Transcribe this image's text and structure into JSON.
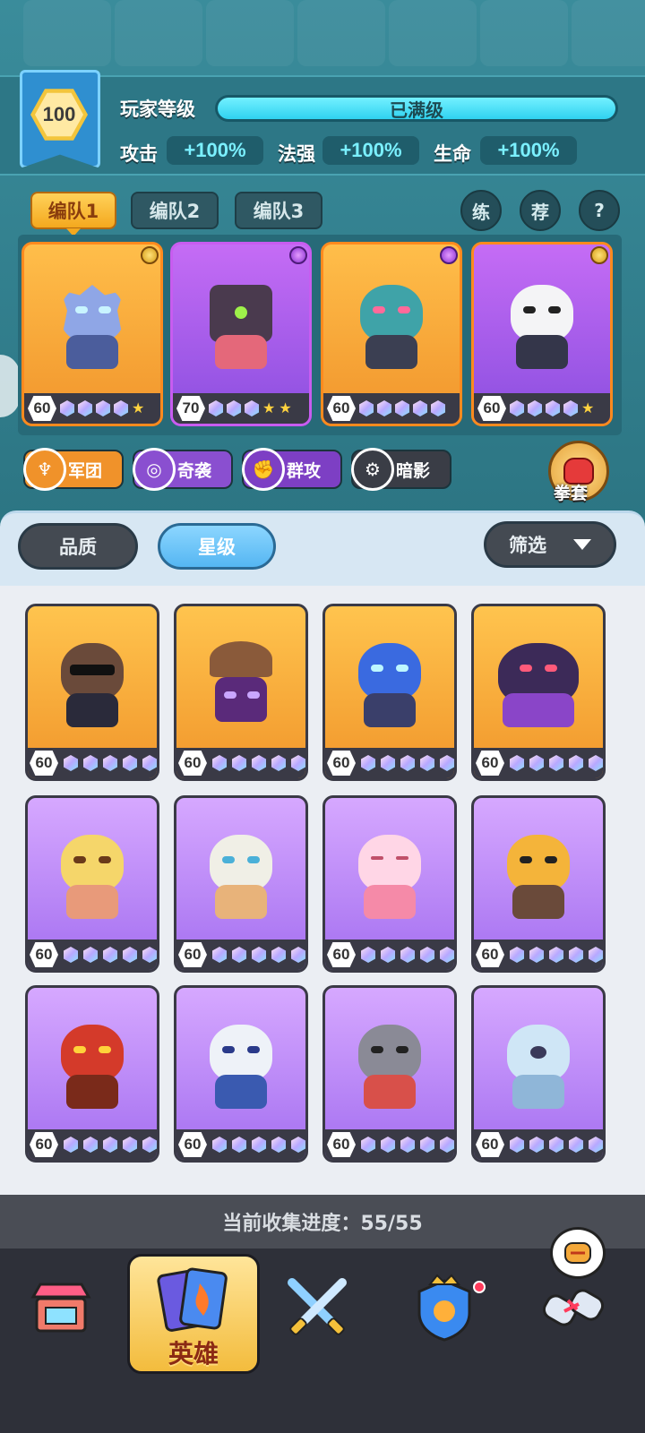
{
  "player": {
    "level": "100",
    "level_label": "玩家等级",
    "level_status": "已满级",
    "stats": [
      {
        "label": "攻击",
        "value": "+100%"
      },
      {
        "label": "法强",
        "value": "+100%"
      },
      {
        "label": "生命",
        "value": "+100%"
      }
    ]
  },
  "teams": {
    "tabs": [
      "编队1",
      "编队2",
      "编队3"
    ],
    "active_index": 0,
    "actions": [
      "练",
      "荐",
      "?"
    ]
  },
  "lineup": [
    {
      "level": "60",
      "stars": 1,
      "frame": "gold",
      "icon": "ice-knight-hero"
    },
    {
      "level": "70",
      "stars": 2,
      "frame": "purple",
      "icon": "demon-chest-hero"
    },
    {
      "level": "60",
      "stars": 0,
      "frame": "gold",
      "icon": "zombie-brute-hero"
    },
    {
      "level": "60",
      "stars": 1,
      "frame": "gold",
      "icon": "panda-hero"
    }
  ],
  "factions": [
    {
      "label": "军团",
      "icon": "trident-icon",
      "color": "#f0922a"
    },
    {
      "label": "奇袭",
      "icon": "swirl-icon",
      "color": "#8a4fd0"
    },
    {
      "label": "群攻",
      "icon": "fist-icon",
      "color": "#7d3fc4"
    },
    {
      "label": "暗影",
      "icon": "gear-icon",
      "color": "#3a3d46"
    }
  ],
  "glove_button": {
    "label": "拳套"
  },
  "filters": {
    "quality": "品质",
    "star": "星级",
    "filter": "筛选"
  },
  "collection": [
    {
      "level": "60",
      "frame": "gold",
      "icon": "sheriff-ape-hero"
    },
    {
      "level": "60",
      "frame": "gold",
      "icon": "straw-hat-ninja-hero"
    },
    {
      "level": "60",
      "frame": "gold",
      "icon": "blue-flame-spirit-hero"
    },
    {
      "level": "60",
      "frame": "gold",
      "icon": "crowned-ghost-hero"
    },
    {
      "level": "60",
      "frame": "violet",
      "icon": "blonde-fighter-hero"
    },
    {
      "level": "60",
      "frame": "violet",
      "icon": "ice-princess-hero"
    },
    {
      "level": "60",
      "frame": "violet",
      "icon": "cupcake-girl-hero"
    },
    {
      "level": "60",
      "frame": "violet",
      "icon": "spartan-warrior-hero"
    },
    {
      "level": "60",
      "frame": "violet",
      "icon": "fire-bull-hero"
    },
    {
      "level": "60",
      "frame": "violet",
      "icon": "ice-wolf-hero"
    },
    {
      "level": "60",
      "frame": "violet",
      "icon": "viking-dwarf-hero"
    },
    {
      "level": "60",
      "frame": "violet",
      "icon": "cyclops-yeti-hero"
    }
  ],
  "progress": {
    "text": "当前收集进度：55/55"
  },
  "nav": {
    "items": [
      "shop-icon",
      "hero-cards-icon",
      "crossed-swords-icon",
      "crown-shield-icon",
      "boxing-glove-icon"
    ],
    "active_label": "英雄"
  }
}
